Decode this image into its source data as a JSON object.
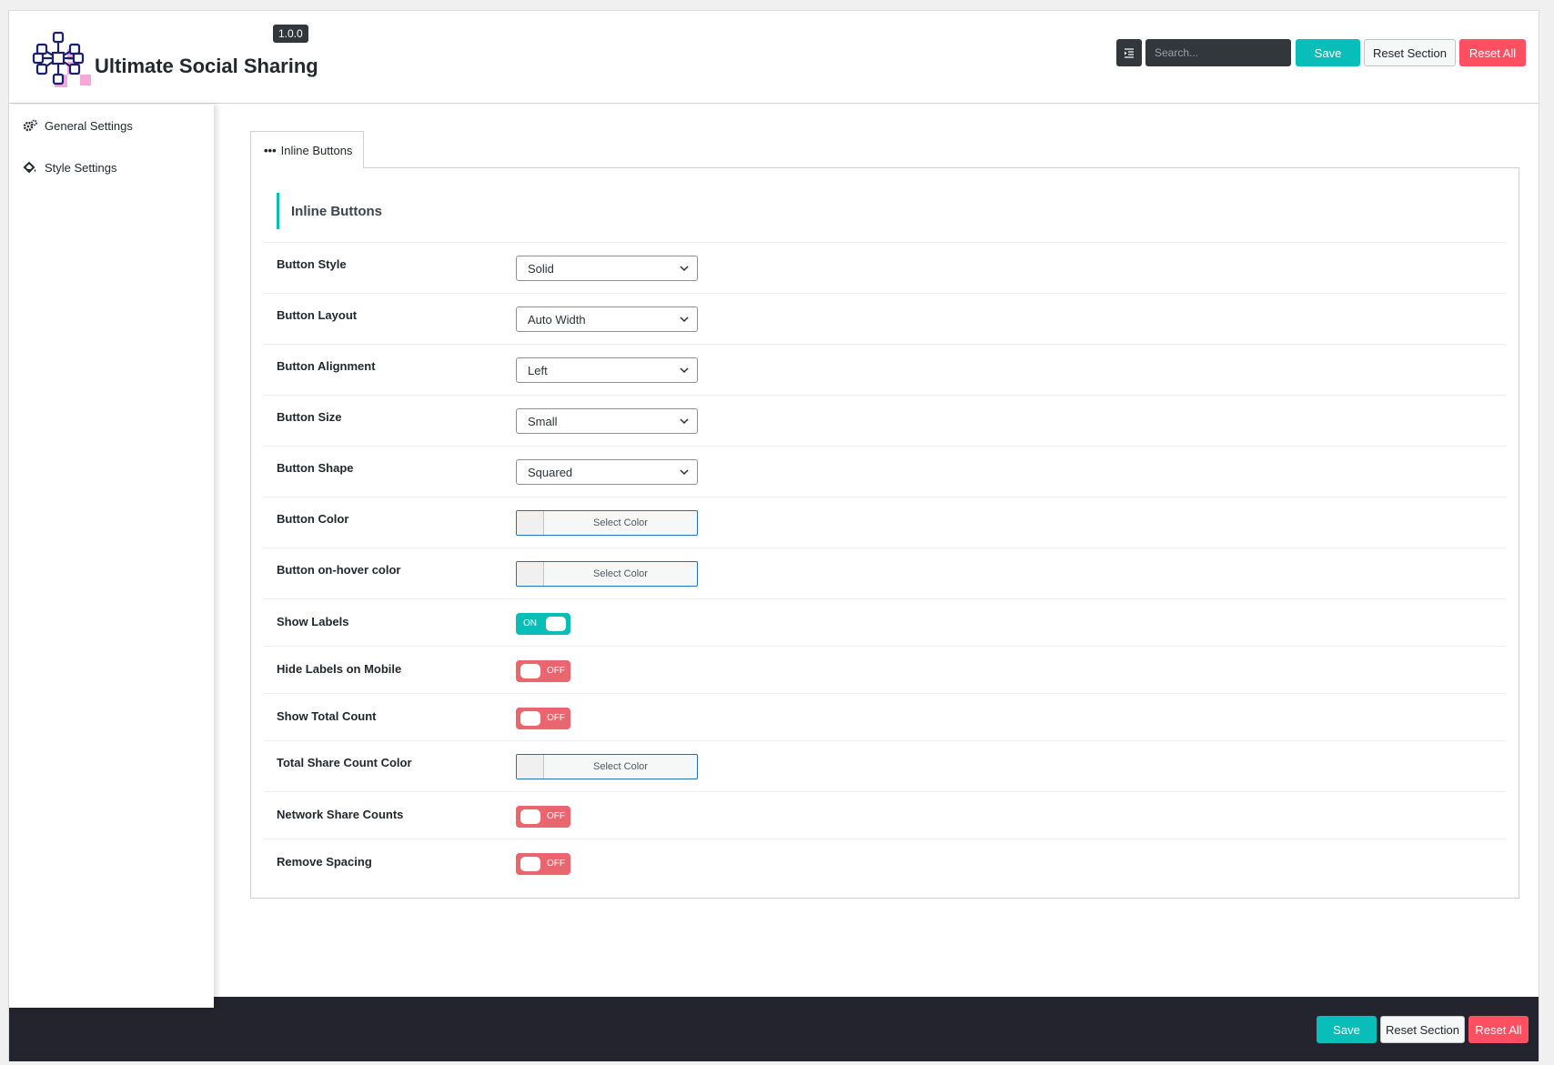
{
  "header": {
    "app_title": "Ultimate Social Sharing",
    "version": "1.0.0",
    "search_placeholder": "Search...",
    "save_label": "Save",
    "reset_section_label": "Reset Section",
    "reset_all_label": "Reset All"
  },
  "sidebar": {
    "items": [
      {
        "label": "General Settings",
        "icon": "gears-icon"
      },
      {
        "label": "Style Settings",
        "icon": "paint-bucket-icon"
      }
    ]
  },
  "tabs": [
    {
      "label": "Inline Buttons",
      "icon": "ellipsis-icon",
      "active": true
    }
  ],
  "section": {
    "title": "Inline Buttons",
    "fields": {
      "button_style": {
        "label": "Button Style",
        "value": "Solid"
      },
      "button_layout": {
        "label": "Button Layout",
        "value": "Auto Width"
      },
      "button_alignment": {
        "label": "Button Alignment",
        "value": "Left"
      },
      "button_size": {
        "label": "Button Size",
        "value": "Small"
      },
      "button_shape": {
        "label": "Button Shape",
        "value": "Squared"
      },
      "button_color": {
        "label": "Button Color",
        "value": "Select Color"
      },
      "button_hover_color": {
        "label": "Button on-hover color",
        "value": "Select Color"
      },
      "show_labels": {
        "label": "Show Labels",
        "state": "ON"
      },
      "hide_labels_mobile": {
        "label": "Hide Labels on Mobile",
        "state": "OFF"
      },
      "show_total_count": {
        "label": "Show Total Count",
        "state": "OFF"
      },
      "total_share_count_color": {
        "label": "Total Share Count Color",
        "value": "Select Color"
      },
      "network_share_counts": {
        "label": "Network Share Counts",
        "state": "OFF"
      },
      "remove_spacing": {
        "label": "Remove Spacing",
        "state": "OFF"
      }
    }
  },
  "footer": {
    "save_label": "Save",
    "reset_section_label": "Reset Section",
    "reset_all_label": "Reset All"
  },
  "colors": {
    "accent": "#09bdb9",
    "danger": "#ff4f60",
    "toggle_off": "#e9666e",
    "dark": "#23242d"
  }
}
